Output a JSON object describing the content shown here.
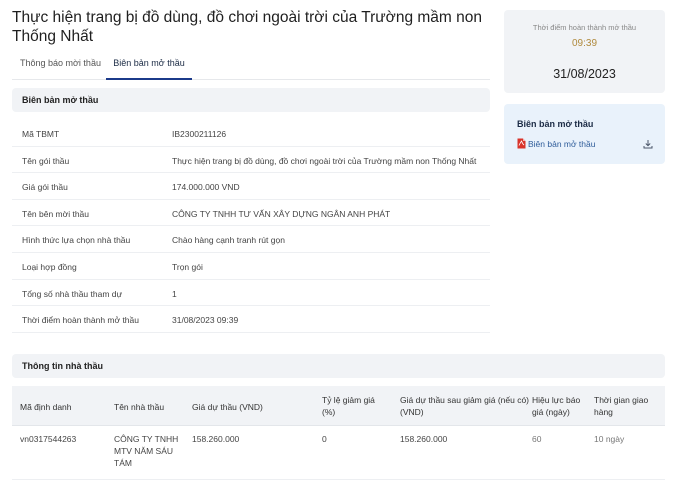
{
  "page": {
    "title": "Thực hiện trang bị đồ dùng, đồ chơi ngoài trời của Trường mầm non Thống Nhất"
  },
  "tabs": [
    {
      "label": "Thông báo mời thầu",
      "active": false
    },
    {
      "label": "Biên bản mở thầu",
      "active": true
    }
  ],
  "opening_record": {
    "heading": "Biên bản mở thầu",
    "rows": [
      {
        "label": "Mã TBMT",
        "value": "IB2300211126"
      },
      {
        "label": "Tên gói thầu",
        "value": "Thực hiện trang bị đồ dùng, đồ chơi ngoài trời của Trường mầm non Thống Nhất"
      },
      {
        "label": "Giá gói thầu",
        "value": "174.000.000 VND"
      },
      {
        "label": "Tên bên mời thầu",
        "value": "CÔNG TY TNHH TƯ VẤN XÂY DỰNG NGÂN ANH PHÁT"
      },
      {
        "label": "Hình thức lựa chọn nhà thầu",
        "value": "Chào hàng cạnh tranh rút gọn"
      },
      {
        "label": "Loại hợp đồng",
        "value": "Trọn gói"
      },
      {
        "label": "Tổng số nhà thầu tham dự",
        "value": "1"
      },
      {
        "label": "Thời điểm hoàn thành mở thầu",
        "value": "31/08/2023 09:39"
      }
    ]
  },
  "completion_card": {
    "label": "Thời điểm hoàn thành mở thầu",
    "time": "09:39",
    "date": "31/08/2023"
  },
  "document_card": {
    "title": "Biên bản mở thầu",
    "link_label": "Biên bản mở thầu"
  },
  "bidders": {
    "heading": "Thông tin nhà thầu",
    "columns": [
      "Mã định danh",
      "Tên nhà thầu",
      "Giá dự thầu (VND)",
      "Tỷ lệ giảm giá (%)",
      "Giá dự thầu sau giảm giá (nếu có) (VND)",
      "Hiệu lực báo giá (ngày)",
      "Thời gian giao hàng"
    ],
    "rows": [
      [
        "vn0317544263",
        "CÔNG TY TNHH MTV NĂM SÁU TÁM",
        "158.260.000",
        "0",
        "158.260.000",
        "60",
        "10 ngày"
      ]
    ]
  },
  "colors": {
    "accent_time": "#b08a3e",
    "tab_active_underline": "#1b3a8a",
    "doc_card_bg": "#e9f2fb",
    "pdf_icon": "#d9342b"
  },
  "icons": {
    "document_link": "pdf-file-icon",
    "download": "download-icon"
  }
}
